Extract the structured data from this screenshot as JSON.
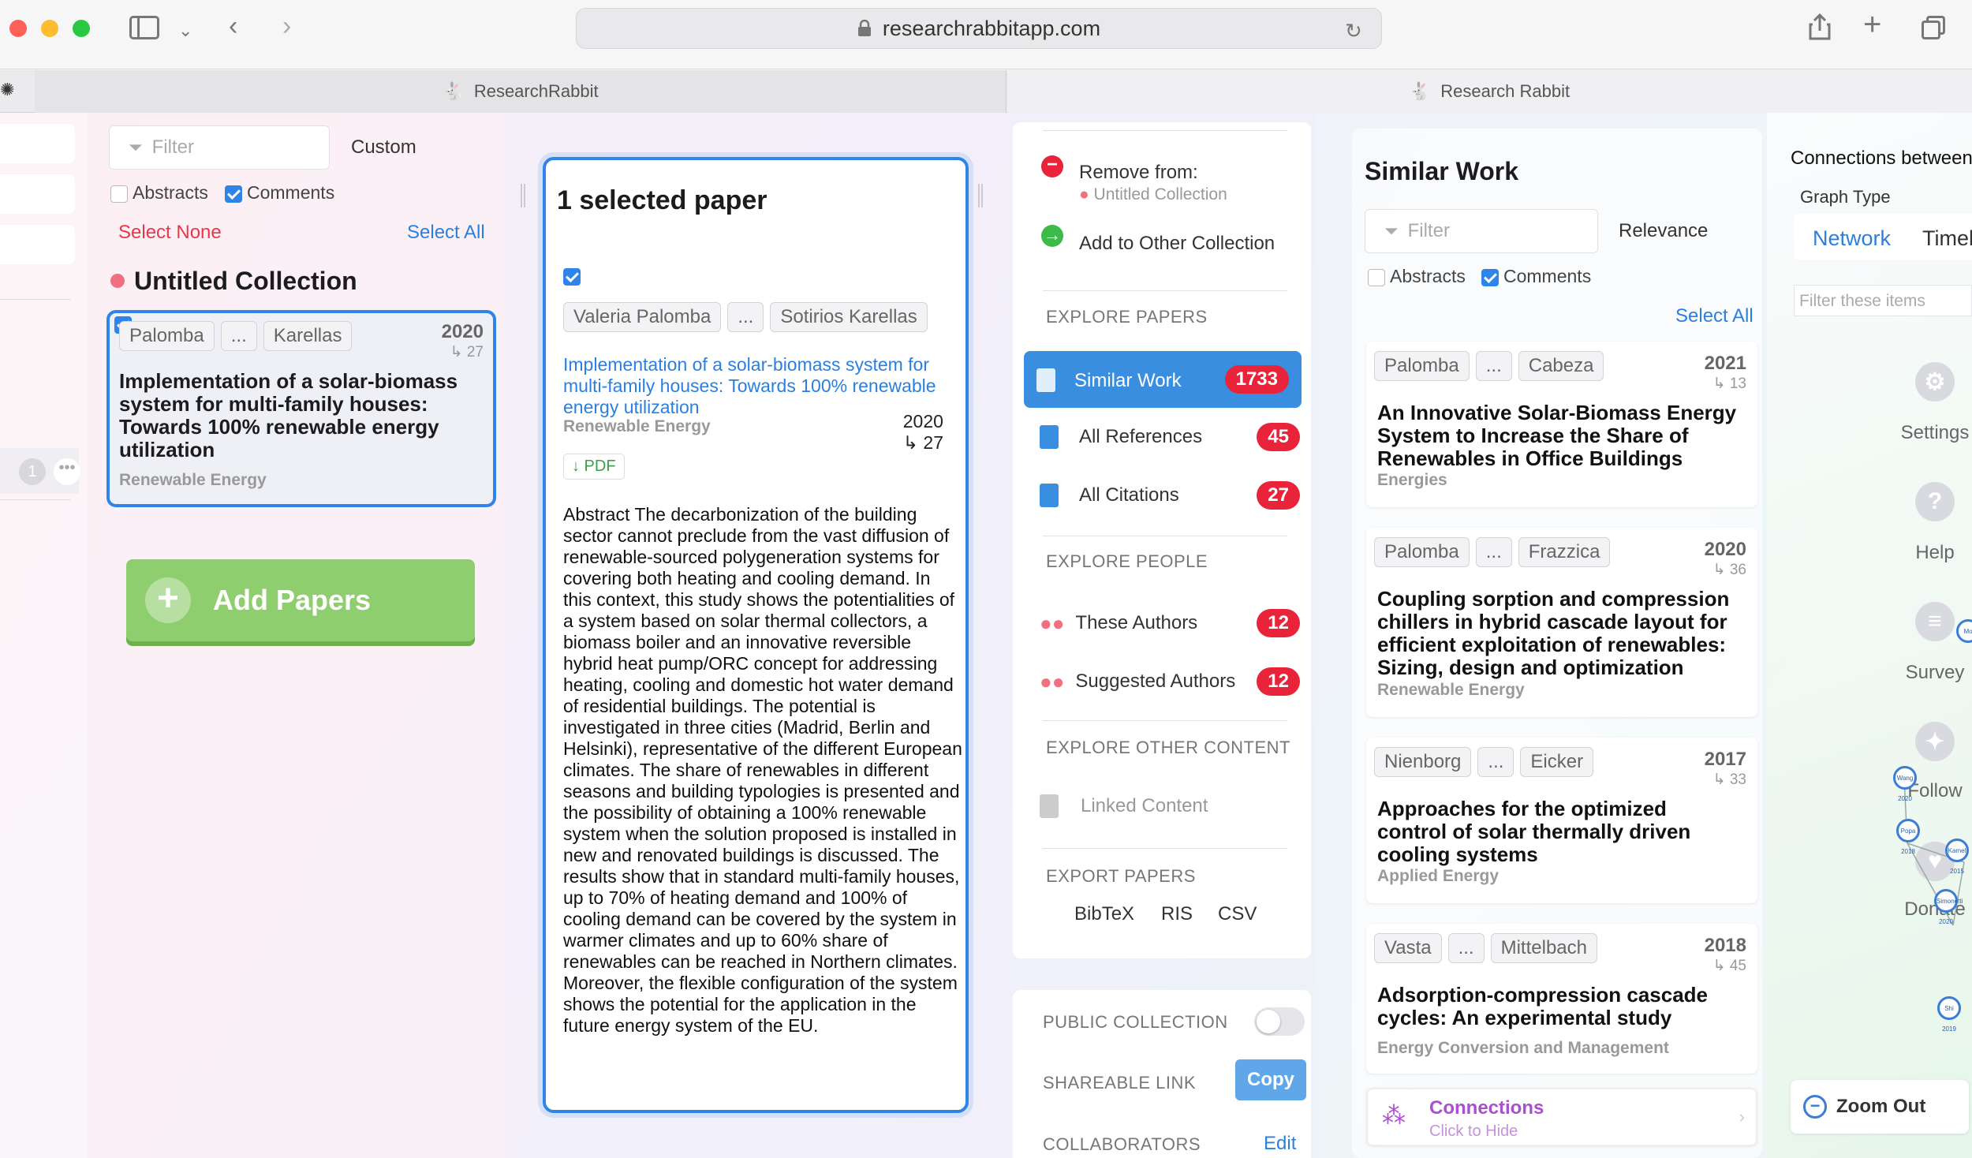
{
  "browser": {
    "url": "researchrabbitapp.com",
    "tab_left": "ResearchRabbit",
    "tab_right": "Research Rabbit"
  },
  "collection": {
    "filter_placeholder": "Filter",
    "sort_label": "Custom",
    "abstracts_label": "Abstracts",
    "comments_label": "Comments",
    "select_none": "Select None",
    "select_all": "Select All",
    "title": "Untitled Collection",
    "paper": {
      "author1": "Palomba",
      "ellipsis": "...",
      "author2": "Karellas",
      "year": "2020",
      "cites": "↳ 27",
      "title": "Implementation of a solar-biomass system for multi-family houses: Towards 100% renewable energy utilization",
      "journal": "Renewable Energy"
    },
    "add_papers": "Add Papers",
    "left_badge": "1"
  },
  "selected": {
    "heading": "1 selected paper",
    "author1": "Valeria Palomba",
    "ellipsis": "...",
    "author2": "Sotirios Karellas",
    "title": "Implementation of a solar-biomass system for multi-family houses: Towards 100% renewable energy utilization",
    "journal": "Renewable Energy",
    "year": "2020",
    "cites": "↳ 27",
    "pdf": "↓ PDF",
    "abstract": "Abstract The decarbonization of the building sector cannot preclude from the vast diffusion of renewable-sourced polygeneration systems for covering both heating and cooling demand. In this context, this study shows the potentialities of a system based on solar thermal collectors, a biomass boiler and an innovative reversible hybrid heat pump/ORC concept for addressing heating, cooling and domestic hot water demand of residential buildings. The potential is investigated in three cities (Madrid, Berlin and Helsinki), representative of the different European climates. The share of renewables in different seasons and building typologies is presented and the possibility of obtaining a 100% renewable system when the solution proposed is installed in new and renovated buildings is discussed. The results show that in standard multi-family houses, up to 70% of heating demand and 100% of cooling demand can be covered by the system in warmer climates and up to 60% share of renewables can be reached in Northern climates. Moreover, the flexible configuration of the system shows the potential for the application in the future energy system of the EU."
  },
  "actions": {
    "remove_from": "Remove from:",
    "remove_collection": "Untitled Collection",
    "add_other": "Add to Other Collection",
    "explore_papers": "EXPLORE PAPERS",
    "similar_work": "Similar Work",
    "similar_count": "1733",
    "all_references": "All References",
    "references_count": "45",
    "all_citations": "All Citations",
    "citations_count": "27",
    "explore_people": "EXPLORE PEOPLE",
    "these_authors": "These Authors",
    "these_count": "12",
    "suggested_authors": "Suggested Authors",
    "suggested_count": "12",
    "explore_other": "EXPLORE OTHER CONTENT",
    "linked_content": "Linked Content",
    "export_papers": "EXPORT PAPERS",
    "bibtex": "BibTeX",
    "ris": "RIS",
    "csv": "CSV",
    "public_collection": "PUBLIC COLLECTION",
    "shareable_link": "SHAREABLE LINK",
    "copy": "Copy",
    "collaborators": "COLLABORATORS",
    "edit": "Edit"
  },
  "similar": {
    "heading": "Similar Work",
    "filter_placeholder": "Filter",
    "sort_label": "Relevance",
    "abstracts_label": "Abstracts",
    "comments_label": "Comments",
    "select_all": "Select All",
    "papers": [
      {
        "a1": "Palomba",
        "a2": "Cabeza",
        "year": "2021",
        "cites": "↳ 13",
        "title": "An Innovative Solar-Biomass Energy System to Increase the Share of Renewables in Office Buildings",
        "journal": "Energies"
      },
      {
        "a1": "Palomba",
        "a2": "Frazzica",
        "year": "2020",
        "cites": "↳ 36",
        "title": "Coupling sorption and compression chillers in hybrid cascade layout for efficient exploitation of renewables: Sizing, design and optimization",
        "journal": "Renewable Energy"
      },
      {
        "a1": "Nienborg",
        "a2": "Eicker",
        "year": "2017",
        "cites": "↳ 33",
        "title": "Approaches for the optimized control of solar thermally driven cooling systems",
        "journal": "Applied Energy"
      },
      {
        "a1": "Vasta",
        "a2": "Mittelbach",
        "year": "2018",
        "cites": "↳ 45",
        "title": "Adsorption-compression cascade cycles: An experimental study",
        "journal": "Energy Conversion and Management"
      }
    ],
    "ellipsis": "...",
    "connections": "Connections",
    "connections_sub": "Click to Hide"
  },
  "graph": {
    "heading": "Connections between",
    "graph_type": "Graph Type",
    "network": "Network",
    "timeline": "Timel",
    "filter_placeholder": "Filter these items",
    "settings": "Settings",
    "help": "Help",
    "survey": "Survey",
    "follow": "Follow",
    "donate": "Donate",
    "zoom_out": "Zoom Out",
    "nodes": [
      "Wang 2020",
      "Popa 2018",
      "Kamel 2015",
      "Simonetti 2020",
      "Shi 2019",
      "Mo"
    ]
  }
}
